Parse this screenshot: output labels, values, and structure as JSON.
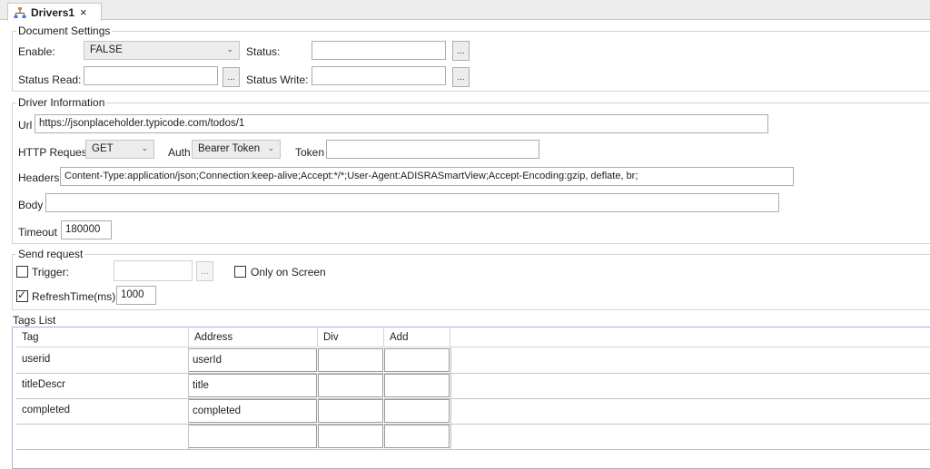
{
  "tab": {
    "title": "Drivers1",
    "close": "×",
    "icon": "drivers-icon"
  },
  "document_settings": {
    "title": "Document Settings",
    "enable_label": "Enable:",
    "enable_value": "FALSE",
    "status_label": "Status:",
    "status_value": "",
    "status_read_label": "Status Read:",
    "status_read_value": "",
    "status_write_label": "Status Write:",
    "status_write_value": "",
    "browse": "..."
  },
  "driver_information": {
    "title": "Driver Information",
    "url_label": "Url",
    "url_value": "https://jsonplaceholder.typicode.com/todos/1",
    "http_request_label": "HTTP Request",
    "http_request_value": "GET",
    "auth_label": "Auth",
    "auth_value": "Bearer Token",
    "token_label": "Token",
    "token_value": "",
    "headers_label": "Headers",
    "headers_value": "Content-Type:application/json;Connection:keep-alive;Accept:*/*;User-Agent:ADISRASmartView;Accept-Encoding:gzip, deflate, br;",
    "body_label": "Body",
    "body_value": "",
    "timeout_label": "Timeout",
    "timeout_value": "180000"
  },
  "send_request": {
    "title": "Send request",
    "trigger_label": "Trigger:",
    "trigger_checked": false,
    "trigger_value": "",
    "browse": "...",
    "only_on_screen_label": "Only on Screen",
    "only_on_screen_checked": false,
    "refresh_label": "RefreshTime(ms):",
    "refresh_checked": true,
    "refresh_value": "1000"
  },
  "tags_list": {
    "title": "Tags List",
    "columns": [
      "Tag",
      "Address",
      "Div",
      "Add"
    ],
    "rows": [
      {
        "tag": "userid",
        "address": "userId",
        "div": "",
        "add": ""
      },
      {
        "tag": "titleDescr",
        "address": "title",
        "div": "",
        "add": ""
      },
      {
        "tag": "completed",
        "address": "completed",
        "div": "",
        "add": ""
      },
      {
        "tag": "",
        "address": "",
        "div": "",
        "add": ""
      }
    ]
  },
  "colors": {
    "accent_border": "#9fb8d8",
    "tab_bg": "#ececec"
  }
}
